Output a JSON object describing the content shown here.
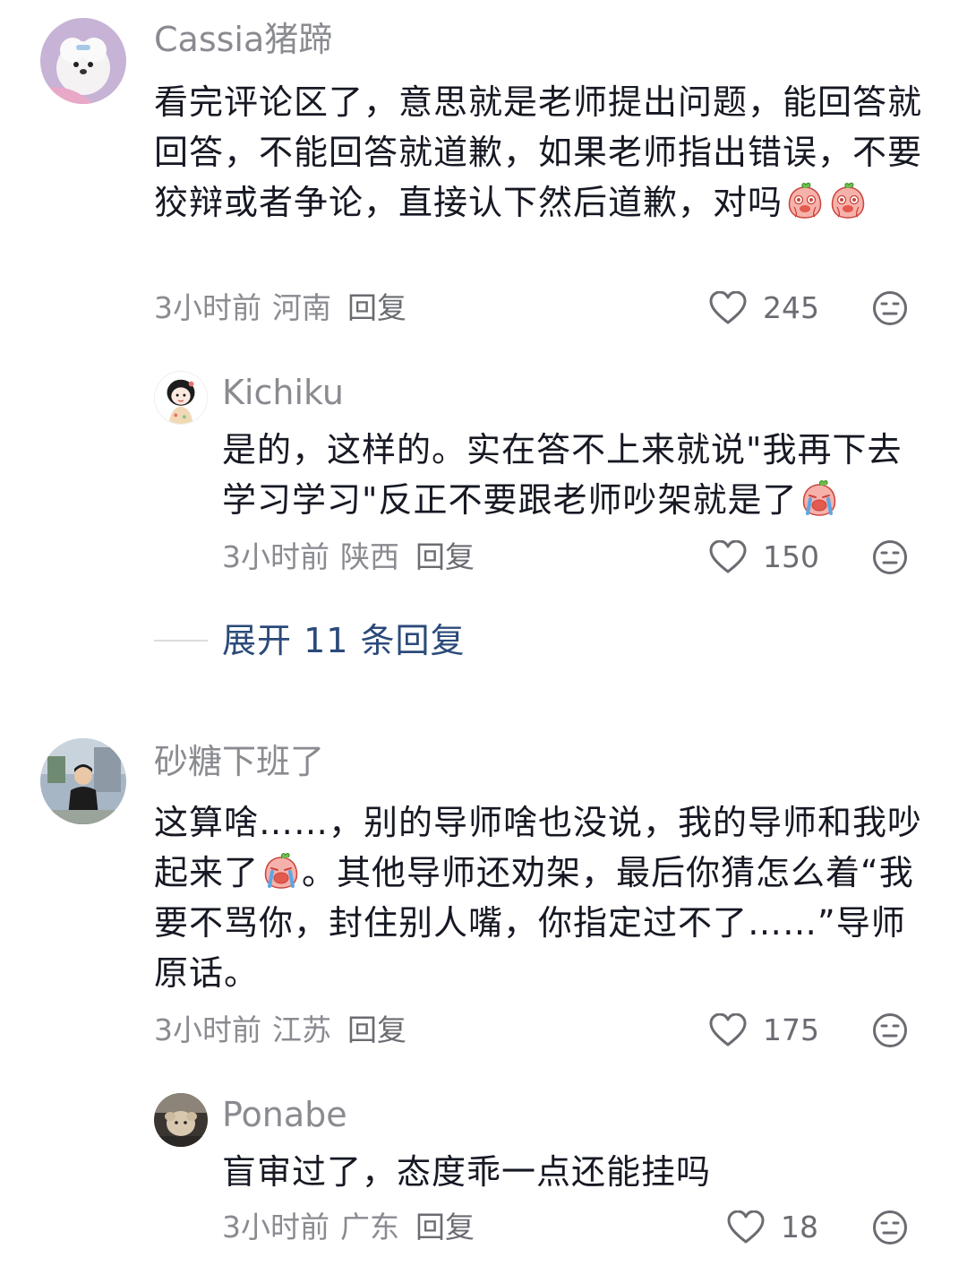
{
  "comments": [
    {
      "username": "Cassia猪蹄",
      "text": "看完评论区了，意思就是老师提出问题，能回答就回答，不能回答就道歉，如果老师指出错误，不要狡辩或者争论，直接认下然后道歉，对吗",
      "time": "3小时前",
      "location": "河南",
      "reply_label": "回复",
      "likes": "245"
    },
    {
      "username": "Kichiku",
      "text": "是的，这样的。实在答不上来就说\"我再下去学习学习\"反正不要跟老师吵架就是了",
      "time": "3小时前",
      "location": "陕西",
      "reply_label": "回复",
      "likes": "150"
    },
    {
      "username": "砂糖下班了",
      "text_part1": "这算啥……，别的导师啥也没说，我的导师和我吵起来了",
      "text_part2": "。其他导师还劝架，最后你猜怎么着“我要不骂你，封住别人嘴，你指定过不了……”导师原话。",
      "time": "3小时前",
      "location": "江苏",
      "reply_label": "回复",
      "likes": "175"
    },
    {
      "username": "Ponabe",
      "text": "盲审过了，态度乖一点还能挂吗",
      "time": "3小时前",
      "location": "广东",
      "reply_label": "回复",
      "likes": "18"
    }
  ],
  "expand_replies": {
    "label": "展开 11 条回复"
  },
  "icons": {
    "like": "heart-outline-icon",
    "dislike": "meh-face-icon",
    "emoji_peach_cry": "peach-crying-emoji"
  },
  "colors": {
    "text": "#161823",
    "secondary": "#8a8b91",
    "link": "#2b4a7a"
  }
}
